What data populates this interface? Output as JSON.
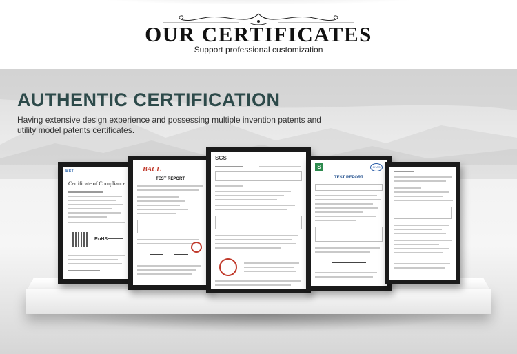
{
  "header": {
    "title": "OUR CERTIFICATES",
    "subtitle": "Support professional customization"
  },
  "section": {
    "title": "AUTHENTIC CERTIFICATION",
    "description_line1": "Having extensive design experience and possessing multiple invention patents and",
    "description_line2": "utility model patents certificates."
  },
  "certificates": {
    "bst": {
      "title": "Certificate of Compliance",
      "logo_text": "BST",
      "mark": "RoHS"
    },
    "bacl": {
      "logo_text": "BACL",
      "heading": "TEST REPORT"
    },
    "sgs": {
      "logo_text": "SGS"
    },
    "test": {
      "logo_text": "S",
      "heading": "TEST REPORT",
      "badge": "CNAS"
    }
  },
  "colors": {
    "section_title": "#2d4a4a",
    "frame": "#1a1a1a",
    "seal_red": "#c0392b"
  }
}
